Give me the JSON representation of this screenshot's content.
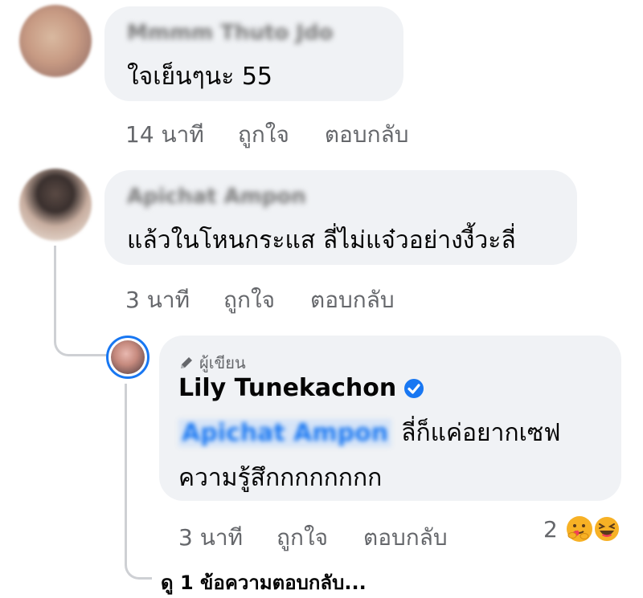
{
  "comments": [
    {
      "author": "Mmmm Thuto Jdo",
      "text": "ใจเย็นๆนะ 55",
      "time": "14 นาที",
      "like": "ถูกใจ",
      "reply": "ตอบกลับ"
    },
    {
      "author": "Apichat Ampon",
      "text": "แล้วในโหนกระแส ลี่ไม่แจ๋วอย่างงี้วะลี่",
      "time": "3 นาที",
      "like": "ถูกใจ",
      "reply": "ตอบกลับ"
    }
  ],
  "reply": {
    "badge": "ผู้เขียน",
    "author": "Lily Tunekachon",
    "mention": "Apichat Ampon",
    "text_line1": "ลี่ก็แค่อยากเซฟ",
    "text_line2": "ความรู้สึกกกกกกกก",
    "time": "3 นาที",
    "like": "ถูกใจ",
    "reply": "ตอบกลับ",
    "reaction_count": "2",
    "reactions": [
      "care-emoji",
      "laugh-emoji"
    ]
  },
  "view_more": "ดู 1 ข้อความตอบกลับ...",
  "colors": {
    "bubble": "#f0f2f5",
    "verified": "#1877f2",
    "meta": "#65676b",
    "mention": "#1877f2"
  }
}
